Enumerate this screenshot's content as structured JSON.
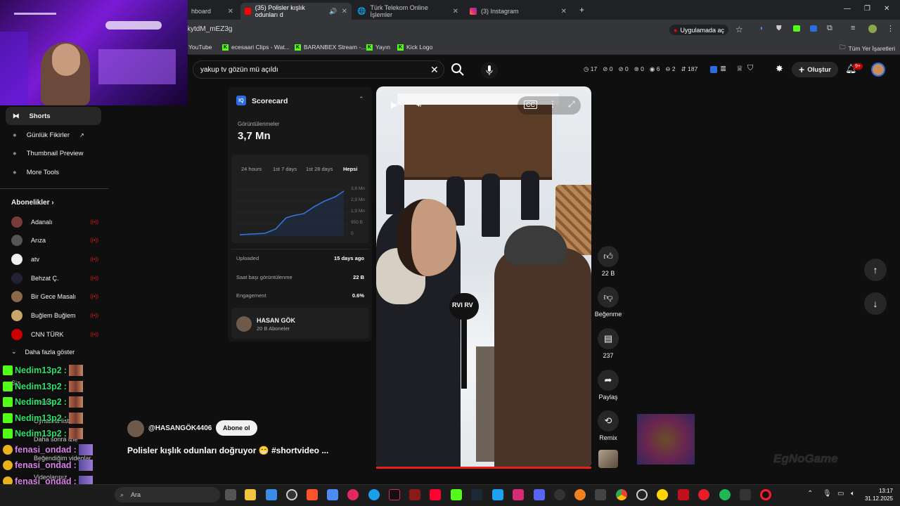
{
  "browser": {
    "tabs": [
      {
        "label": "hboard"
      },
      {
        "label": "(35) Polisler kışlık odunları d"
      },
      {
        "label": "Türk Telekom Online İşlemler"
      },
      {
        "label": "(3) Instagram"
      }
    ],
    "url": "kytdM_mEZ3g",
    "open_app": "Uygulamada aç",
    "bookmarks": [
      "YouTube",
      "ecesaari Clips - Wat...",
      "BARANBEX Stream -...",
      "Yayın",
      "Kick Logo"
    ],
    "all_bookmarks": "Tüm Yer İşaretleri"
  },
  "youtube": {
    "search_value": "yakup tv gözün mü açıldı",
    "stats": [
      "17",
      "0",
      "0",
      "0",
      "6",
      "2",
      "187"
    ],
    "create_label": "Oluştur",
    "notif_count": "9+"
  },
  "sidebar": {
    "items": [
      {
        "label": "Shorts"
      },
      {
        "label": "Günlük Fikirler"
      },
      {
        "label": "Thumbnail Preview"
      },
      {
        "label": "More Tools"
      }
    ],
    "subs_header": "Abonelikler",
    "subscriptions": [
      {
        "name": "Adanalı"
      },
      {
        "name": "Arıza"
      },
      {
        "name": "atv"
      },
      {
        "name": "Behzat Ç."
      },
      {
        "name": "Bir Gece Masalı"
      },
      {
        "name": "Buğlem Buğlem"
      },
      {
        "name": "CNN TÜRK"
      }
    ],
    "show_more": "Daha fazla göster",
    "hidden_items": [
      "Siz",
      "Geçmiş",
      "Oynatma listeleri",
      "Daha sonra izle",
      "Beğendiğim videolar",
      "Videolarınız"
    ]
  },
  "scorecard": {
    "title": "Scorecard",
    "views_label": "Görüntülenmeler",
    "views_value": "3,7 Mn",
    "ranges": [
      "24 hours",
      "1st 7 days",
      "1st 28 days",
      "Hepsi"
    ],
    "y_ticks": [
      "3,8 Mn",
      "2,9 Mn",
      "1,9 Mn",
      "950 B",
      "0"
    ],
    "rows": [
      {
        "label": "Uploaded",
        "value": "15 days ago"
      },
      {
        "label": "Saat başı görüntülenme",
        "value": "22 B"
      },
      {
        "label": "Engagement",
        "value": "0.6%"
      }
    ],
    "channel_name": "HASAN GÖK",
    "channel_subs": "20 B Aboneler"
  },
  "video": {
    "mic_text": "RVI  RV",
    "channel_handle": "@HASANGÖK4406",
    "subscribe_label": "Abone ol",
    "title": "Polisler kışlık odunları doğruyor 😁 #shortvideo ..."
  },
  "actions": {
    "like_count": "22 B",
    "dislike_label": "Beğenme",
    "comments_count": "237",
    "share_label": "Paylaş",
    "remix_label": "Remix"
  },
  "chat": {
    "messages": [
      {
        "user": "Nedim13p2",
        "color": "#2ee06a"
      },
      {
        "user": "Nedim13p2",
        "color": "#2ee06a"
      },
      {
        "user": "Nedim13p2",
        "color": "#2ee06a"
      },
      {
        "user": "Nedim13p2",
        "color": "#2ee06a"
      },
      {
        "user": "Nedim13p2",
        "color": "#2ee06a"
      },
      {
        "user": "fenasi_ondad",
        "color": "#d982e8"
      },
      {
        "user": "fenasi_ondad",
        "color": "#d982e8"
      },
      {
        "user": "fenasi_ondad",
        "color": "#d982e8"
      },
      {
        "user": "fenasi_ondad",
        "color": "#d982e8"
      }
    ]
  },
  "taskbar": {
    "search_placeholder": "Ara",
    "time": "13:17",
    "date": "31.12.2025"
  },
  "watermark": "EgNoGame"
}
